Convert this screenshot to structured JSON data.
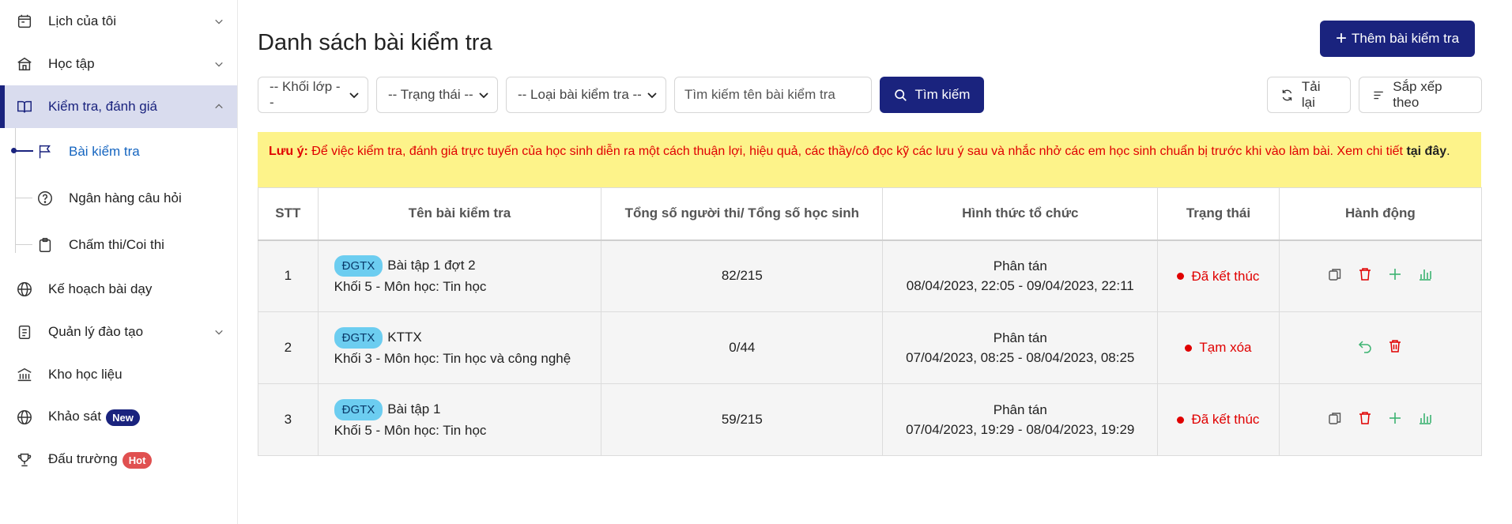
{
  "sidebar": {
    "items": [
      {
        "label": "Lịch của tôi",
        "icon": "calendar-icon",
        "has_chevron": true
      },
      {
        "label": "Học tập",
        "icon": "school-icon",
        "has_chevron": true
      },
      {
        "label": "Kiểm tra, đánh giá",
        "icon": "book-open-icon",
        "has_chevron": true,
        "active": true
      },
      {
        "label": "Kế hoạch bài dạy",
        "icon": "globe-icon"
      },
      {
        "label": "Quản lý đào tạo",
        "icon": "clipboard-icon",
        "has_chevron": true
      },
      {
        "label": "Kho học liệu",
        "icon": "library-icon"
      },
      {
        "label": "Khảo sát",
        "icon": "globe-icon",
        "badge": "New"
      },
      {
        "label": "Đấu trường",
        "icon": "trophy-icon",
        "badge": "Hot"
      }
    ],
    "subitems": [
      {
        "label": "Bài kiểm tra",
        "icon": "flag-icon",
        "active": true
      },
      {
        "label": "Ngân hàng câu hỏi",
        "icon": "question-circle-icon"
      },
      {
        "label": "Chấm thi/Coi thi",
        "icon": "clipboard-icon"
      }
    ]
  },
  "main": {
    "title": "Danh sách bài kiểm tra",
    "add_button": "Thêm bài kiểm tra",
    "filters": {
      "grade": "-- Khối lớp --",
      "status": "-- Trạng thái --",
      "type": "-- Loại bài kiểm tra --",
      "search_placeholder": "Tìm kiếm tên bài kiểm tra",
      "search_button": "Tìm kiếm"
    },
    "reload_button": "Tải lại",
    "sort_button": "Sắp xếp theo",
    "notice": {
      "lead": "Lưu ý:",
      "text": " Để việc kiểm tra, đánh giá trực tuyến của học sinh diễn ra một cách thuận lợi, hiệu quả, các thầy/cô đọc kỹ các lưu ý sau và nhắc nhở các em học sinh chuẩn bị trước khi vào làm bài. Xem chi tiết ",
      "link": "tại đây",
      "end": "."
    },
    "table": {
      "headers": [
        "STT",
        "Tên bài kiểm tra",
        "Tổng số người thi/ Tổng số học sinh",
        "Hình thức tổ chức",
        "Trạng thái",
        "Hành động"
      ],
      "rows": [
        {
          "stt": "1",
          "tag": "ĐGTX",
          "name": "Bài tập 1 đợt 2",
          "sub": "Khối 5 - Môn học: Tin học",
          "count": "82/215",
          "org": "Phân tán",
          "time": "08/04/2023, 22:05 - 09/04/2023, 22:11",
          "status": "Đã kết thúc",
          "actions": [
            "copy-icon",
            "trash-icon",
            "plus-icon",
            "bar-chart-icon"
          ]
        },
        {
          "stt": "2",
          "tag": "ĐGTX",
          "name": "KTTX",
          "sub": "Khối 3 - Môn học: Tin học và công nghệ",
          "count": "0/44",
          "org": "Phân tán",
          "time": "07/04/2023, 08:25 - 08/04/2023, 08:25",
          "status": "Tạm xóa",
          "actions": [
            "restore-icon",
            "trash-icon"
          ]
        },
        {
          "stt": "3",
          "tag": "ĐGTX",
          "name": "Bài tập 1",
          "sub": "Khối 5 - Môn học: Tin học",
          "count": "59/215",
          "org": "Phân tán",
          "time": "07/04/2023, 19:29 - 08/04/2023, 19:29",
          "status": "Đã kết thúc",
          "actions": [
            "copy-icon",
            "trash-icon",
            "plus-icon",
            "bar-chart-icon"
          ]
        }
      ]
    }
  },
  "colors": {
    "primary": "#1a237e",
    "danger": "#e00000",
    "success": "#3cb371",
    "notice_bg": "#fdf38a",
    "tag_bg": "#6ccdf0"
  }
}
